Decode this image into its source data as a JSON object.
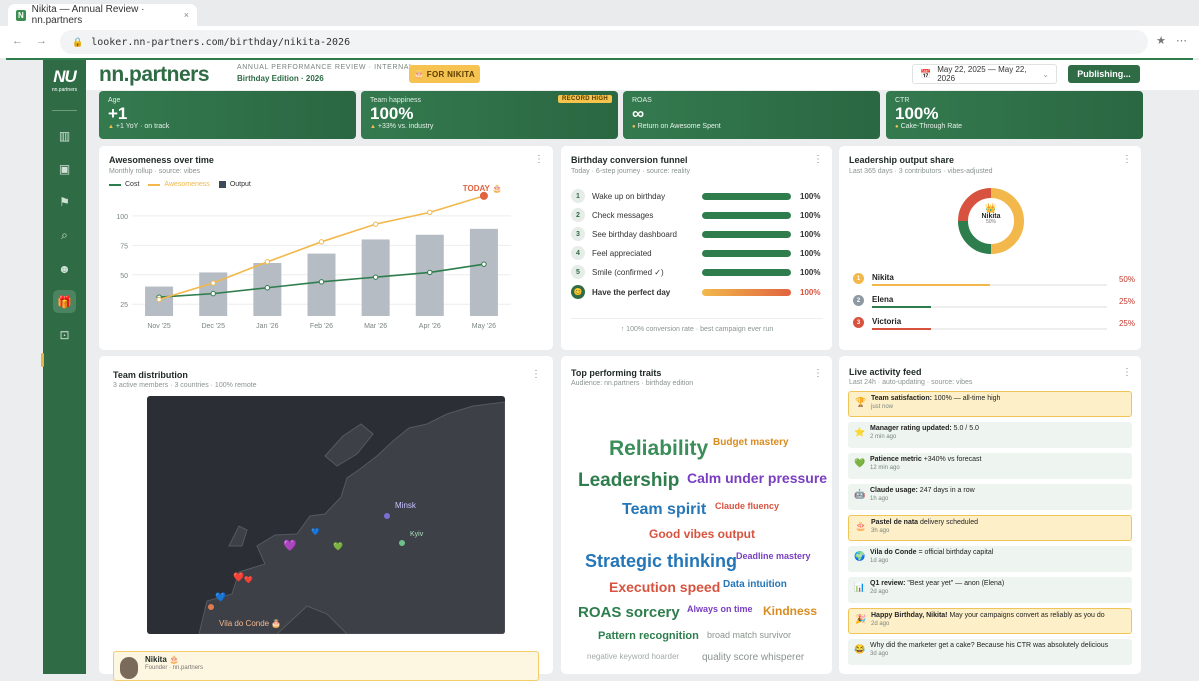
{
  "browser": {
    "tab_title": "Nikita — Annual Review · nn.partners",
    "tab_favicon": "N",
    "tab_close": "×",
    "url": "looker.nn-partners.com/birthday/nikita-2026",
    "nav_icons": "← → ○",
    "lock_icon": "🔒",
    "star_icon": "★",
    "menu_icon": "⋯"
  },
  "sidebar": {
    "logo": "NU",
    "logo_sub": "nn.partners",
    "icons": [
      "bar-chart-icon",
      "image-icon",
      "flag-icon",
      "search-icon",
      "users-icon",
      "gift-icon",
      "camera-icon"
    ],
    "glyphs": [
      "▥",
      "▣",
      "⚑",
      "⌕",
      "☻",
      "🎁",
      "⊡"
    ],
    "active_index": 5
  },
  "header": {
    "brand": "nn.partners",
    "subtitle": "ANNUAL PERFORMANCE REVIEW · INTERNAL",
    "title": "Birthday Edition · 2026",
    "for_button": "🎂 FOR NIKITA",
    "date_range": "May 22, 2025 — May 22, 2026",
    "date_caret": "⌄",
    "calendar_icon": "📅",
    "publish_button": "Publishing..."
  },
  "kpis": [
    {
      "label": "Age",
      "value": "+1",
      "sub": "+1 YoY · on track",
      "tri": "▲",
      "badge": ""
    },
    {
      "label": "Team happiness",
      "value": "100%",
      "sub": "+33% vs. industry",
      "tri": "▲",
      "badge": "RECORD HIGH"
    },
    {
      "label": "ROAS",
      "value": "∞",
      "sub": "Return on Awesome Spent",
      "tri": "●",
      "badge": ""
    },
    {
      "label": "CTR",
      "value": "100%",
      "sub": "Cake-Through Rate",
      "tri": "●",
      "badge": ""
    }
  ],
  "awesomeness": {
    "title": "Awesomeness over time",
    "subtitle": "Monthly rollup · source: vibes",
    "kebab": "⋮",
    "legend": [
      "Cost",
      "Awesomeness",
      "Output"
    ],
    "today_label": "TODAY 🎂"
  },
  "chart_data": {
    "type": "bar",
    "categories": [
      "Nov '25",
      "Dec '25",
      "Jan '26",
      "Feb '26",
      "Mar '26",
      "Apr '26",
      "May '26"
    ],
    "series": [
      {
        "name": "Output",
        "type": "bar",
        "values": [
          40,
          52,
          60,
          68,
          80,
          84,
          89
        ],
        "color": "#b5bcc3"
      },
      {
        "name": "Cost",
        "type": "line",
        "values": [
          31,
          34,
          39,
          44,
          48,
          52,
          59
        ],
        "color": "#2e7d4d"
      },
      {
        "name": "Awesomeness",
        "type": "line",
        "values": [
          29,
          43,
          61,
          78,
          93,
          103,
          117
        ],
        "color": "#f2b84b"
      }
    ],
    "yticks": [
      25,
      50,
      75,
      100
    ],
    "ylim": [
      15,
      122
    ]
  },
  "funnel": {
    "title": "Birthday conversion funnel",
    "subtitle": "Today · 6-step journey · source: reality",
    "kebab": "⋮",
    "steps": [
      {
        "num": "1",
        "label": "Wake up on birthday",
        "pct": "100%"
      },
      {
        "num": "2",
        "label": "Check messages",
        "pct": "100%"
      },
      {
        "num": "3",
        "label": "See birthday dashboard",
        "pct": "100%"
      },
      {
        "num": "4",
        "label": "Feel appreciated",
        "pct": "100%"
      },
      {
        "num": "5",
        "label": "Smile (confirmed ✓)",
        "pct": "100%"
      },
      {
        "num": "😊",
        "label": "Have the perfect day",
        "pct": "100%"
      }
    ],
    "footer": "↑ 100% conversion rate · best campaign ever run"
  },
  "leadership": {
    "title": "Leadership output share",
    "subtitle": "Last 365 days · 3 contributors · vibes-adjusted",
    "kebab": "⋮",
    "donut_icon": "👑",
    "donut_name": "Nikita",
    "donut_pct": "50%",
    "rows": [
      {
        "rank": "1",
        "name": "Nikita",
        "pct": "50%",
        "share": 0.5,
        "color": "#f2b84b",
        "rank_color": "#f2b84b"
      },
      {
        "rank": "2",
        "name": "Elena",
        "pct": "25%",
        "share": 0.25,
        "color": "#2e7d4d",
        "rank_color": "#8e9aa3"
      },
      {
        "rank": "3",
        "name": "Victoria",
        "pct": "25%",
        "share": 0.25,
        "color": "#d8533f",
        "rank_color": "#d8533f"
      }
    ]
  },
  "team": {
    "title": "Team distribution",
    "subtitle": "3 active members · 3 countries · 100% remote",
    "kebab": "⋮",
    "map_labels": [
      "Minsk",
      "Kyiv",
      "Vila do Conde 🎂"
    ],
    "profile_name": "Nikita 🎂",
    "profile_role": "Founder · nn.partners"
  },
  "traits": {
    "title": "Top performing traits",
    "subtitle": "Audience: nn.partners · birthday edition",
    "kebab": "⋮",
    "words": [
      "Reliability",
      "Budget mastery",
      "Leadership",
      "Calm under pressure",
      "Team spirit",
      "Claude fluency",
      "Good vibes output",
      "Strategic thinking",
      "Deadline mastery",
      "Execution speed",
      "Data intuition",
      "ROAS sorcery",
      "Always on time",
      "Kindness",
      "Pattern recognition",
      "broad match survivor",
      "negative keyword hoarder",
      "quality score whisperer"
    ]
  },
  "feed": {
    "title": "Live activity feed",
    "subtitle": "Last 24h · auto-updating · source: vibes",
    "kebab": "⋮",
    "items": [
      {
        "icon": "🏆",
        "bold": "Team satisfaction:",
        "text": " 100% — all-time high",
        "time": "just now",
        "style": "hi"
      },
      {
        "icon": "⭐",
        "bold": "Manager rating updated:",
        "text": " 5.0 / 5.0",
        "time": "2 min ago",
        "style": "plain"
      },
      {
        "icon": "💚",
        "bold": "Patience metric",
        "text": " +340% vs forecast",
        "time": "12 min ago",
        "style": "plain"
      },
      {
        "icon": "🤖",
        "bold": "Claude usage:",
        "text": " 247 days in a row",
        "time": "1h ago",
        "style": "plain"
      },
      {
        "icon": "🎂",
        "bold": "Pastel de nata",
        "text": " delivery scheduled",
        "time": "3h ago",
        "style": "hi"
      },
      {
        "icon": "🌍",
        "bold": "Vila do Conde",
        "text": " = official birthday capital",
        "time": "1d ago",
        "style": "plain"
      },
      {
        "icon": "📊",
        "bold": "Q1 review:",
        "text": " \"Best year yet\" — anon (Elena)",
        "time": "2d ago",
        "style": "plain"
      },
      {
        "icon": "🎉",
        "bold": "Happy Birthday, Nikita!",
        "text": " May your campaigns convert as reliably as you do",
        "time": "2d ago",
        "style": "hi"
      },
      {
        "icon": "😂",
        "bold": "",
        "text": "Why did the marketer get a cake? Because his CTR was absolutely delicious",
        "time": "3d ago",
        "style": "plain"
      }
    ]
  }
}
